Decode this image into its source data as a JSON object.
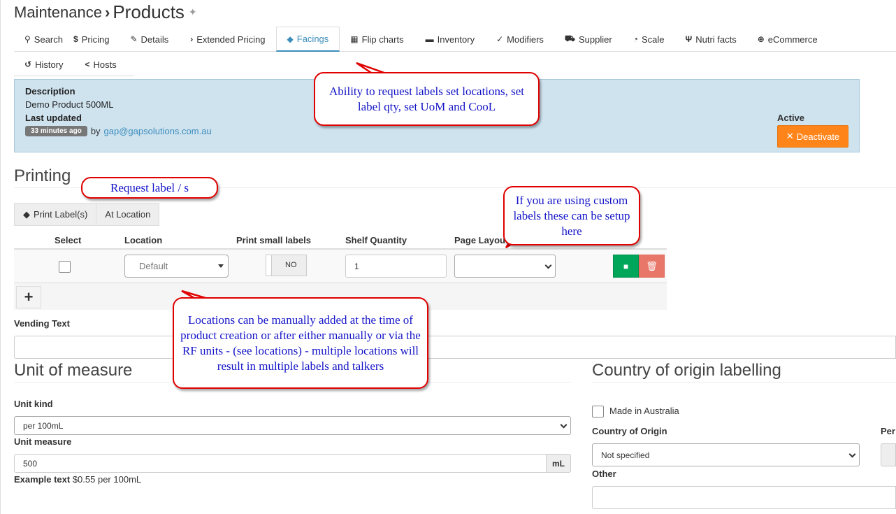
{
  "breadcrumb": {
    "parent": "Maintenance",
    "separator": "›",
    "title": "Products"
  },
  "tabs": [
    {
      "icon": "search-icon",
      "glyph": "⚲",
      "label": "Search"
    },
    {
      "icon": "dollar-icon",
      "glyph": "$",
      "label": "Pricing"
    },
    {
      "icon": "edit-icon",
      "glyph": "✎",
      "label": "Details"
    },
    {
      "icon": "chevron-right-icon",
      "glyph": "›",
      "label": "Extended Pricing"
    },
    {
      "icon": "tags-icon",
      "glyph": "🏷",
      "label": "Facings"
    },
    {
      "icon": "grid-icon",
      "glyph": "▦",
      "label": "Flip charts"
    },
    {
      "icon": "inventory-icon",
      "glyph": "▬",
      "label": "Inventory"
    },
    {
      "icon": "check-circle-icon",
      "glyph": "✓",
      "label": "Modifiers"
    },
    {
      "icon": "truck-icon",
      "glyph": "⛟",
      "label": "Supplier"
    },
    {
      "icon": "gauge-icon",
      "glyph": "◔",
      "label": "Scale"
    },
    {
      "icon": "utensils-icon",
      "glyph": "Ψ",
      "label": "Nutri facts"
    },
    {
      "icon": "globe-icon",
      "glyph": "⊕",
      "label": "eCommerce"
    }
  ],
  "tabs2": [
    {
      "icon": "history-icon",
      "glyph": "↺",
      "label": "History"
    },
    {
      "icon": "share-icon",
      "glyph": "<",
      "label": "Hosts"
    }
  ],
  "info": {
    "description_label": "Description",
    "description_value": "Demo Product 500ML",
    "updated_label": "Last updated",
    "updated_badge": "33 minutes ago",
    "by": "by",
    "user": "gap@gapsolutions.com.au",
    "active_label": "Active",
    "deactivate": "Deactivate"
  },
  "printing": {
    "title": "Printing",
    "print_labels": "Print Label(s)",
    "at_location": "At Location",
    "headers": [
      "Select",
      "Location",
      "Print small labels",
      "Shelf Quantity",
      "Page Layout"
    ],
    "row": {
      "location": "Default",
      "small_labels": "NO",
      "shelf_qty": "1",
      "page_layout": ""
    },
    "add": "+"
  },
  "vending_text_label": "Vending Text",
  "uom": {
    "title": "Unit of measure",
    "unit_kind_label": "Unit kind",
    "unit_kind_value": "per 100mL",
    "unit_measure_label": "Unit measure",
    "unit_measure_value": "500",
    "unit_addon": "mL",
    "example_label": "Example text",
    "example_value": "$0.55 per 100mL"
  },
  "cool": {
    "title": "Country of origin labelling",
    "made_in_aus": "Made in Australia",
    "country_label": "Country of Origin",
    "country_value": "Not specified",
    "per_label": "Per",
    "other_label": "Other"
  },
  "callouts": {
    "facings": "Ability to request labels set locations, set label qty, set UoM and CooL",
    "request": "Request label / s",
    "custom": "If you are using custom labels these can be setup here",
    "locations": "Locations can be manually added at the time of product creation or after either manually or via the RF units - (see locations) - multiple locations will result in multiple labels and talkers"
  },
  "colors": {
    "accent": "#3c8dbc",
    "info_bg": "#cfe3ef",
    "warning": "#ff851b",
    "success": "#00a65a",
    "danger": "#e8776a",
    "callout_border": "#e00000",
    "callout_text": "#1414c8"
  }
}
